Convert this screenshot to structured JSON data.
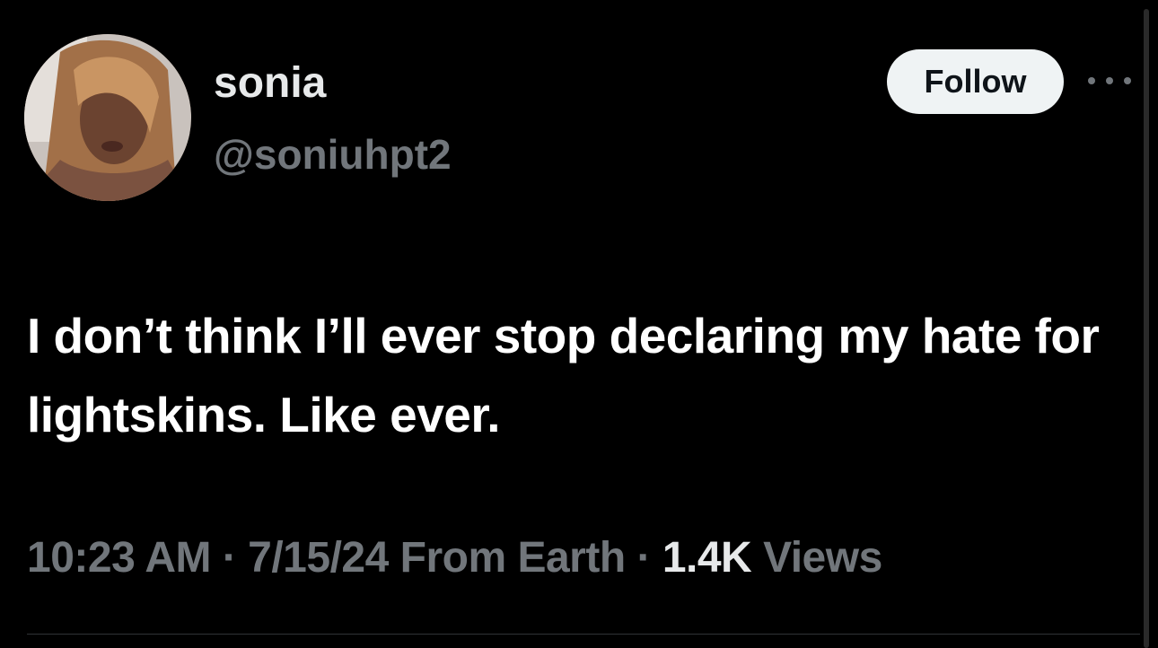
{
  "user": {
    "display_name": "sonia",
    "handle": "@soniuhpt2"
  },
  "actions": {
    "follow_label": "Follow",
    "more_icon": "more-horizontal-icon"
  },
  "tweet": {
    "text": "I don’t think I’ll ever stop declaring my hate for lightskins. Like ever."
  },
  "meta": {
    "time": "10:23 AM",
    "separator": "·",
    "date_source": "7/15/24 From Earth",
    "views_count": "1.4K",
    "views_label": "Views"
  },
  "colors": {
    "background": "#000000",
    "text_primary": "#e7e9ea",
    "text_secondary": "#71767b",
    "follow_bg": "#eff3f4",
    "follow_text": "#0f1419"
  }
}
